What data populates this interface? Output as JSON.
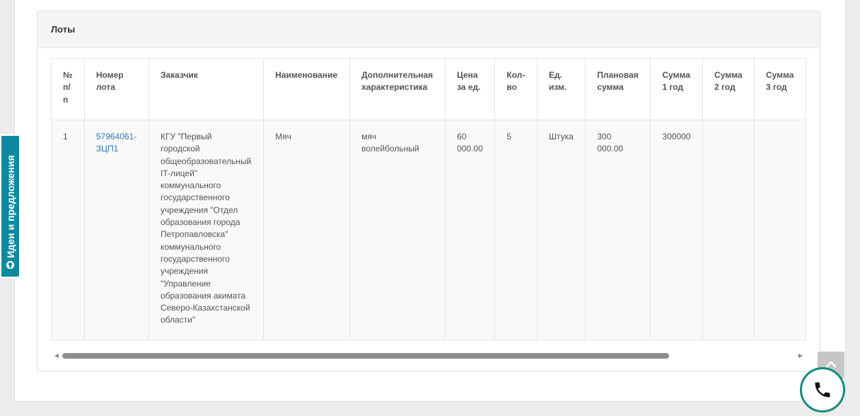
{
  "panel": {
    "title": "Лоты"
  },
  "table": {
    "headers": [
      "№ п/п",
      "Номер лота",
      "Заказчик",
      "Наименование",
      "Дополнительная характеристика",
      "Цена за ед.",
      "Кол-во",
      "Ед. изм.",
      "Плановая сумма",
      "Сумма 1 год",
      "Сумма 2 год",
      "Сумма 3 год"
    ],
    "rows": [
      [
        "1",
        "57964061-ЗЦП1",
        "КГУ \"Первый городской общеобразовательный IT-лицей\" коммунального государственного учреждения \"Отдел образования города Петропавловска\" коммунального государственного учреждения \"Управление образования акимата Северо-Казахстанской области\"",
        "Мяч",
        "мяч волейбольный",
        "60 000.00",
        "5",
        "Штука",
        "300 000.00",
        "300000",
        "",
        ""
      ]
    ]
  },
  "feedback": {
    "label": "Идеи и предложения",
    "icon": "lightbulb-icon"
  },
  "scroll_top": {
    "icon": "chevron-up-icon"
  },
  "call": {
    "icon": "phone-icon",
    "color": "#138a7d"
  },
  "colors": {
    "link": "#2f78b5",
    "feedback_tab": "#0e8aa0"
  }
}
